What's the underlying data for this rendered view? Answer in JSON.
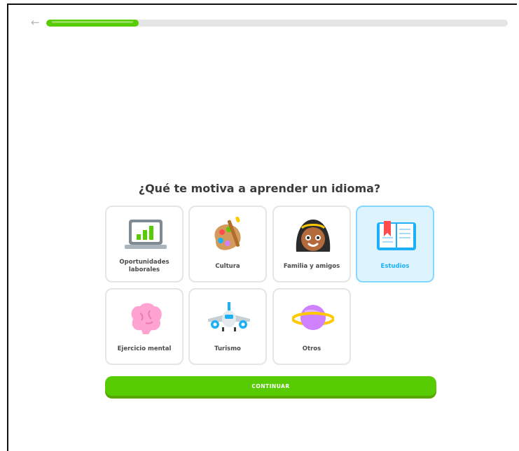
{
  "progress": {
    "fraction": 0.2
  },
  "question": "¿Qué te motiva a aprender un idioma?",
  "options": [
    {
      "label": "Oportunidades laborales",
      "icon": "laptop-chart-icon"
    },
    {
      "label": "Cultura",
      "icon": "palette-icon"
    },
    {
      "label": "Familia y amigos",
      "icon": "family-face-icon"
    },
    {
      "label": "Estudios",
      "icon": "book-icon",
      "selected": true
    },
    {
      "label": "Ejercicio mental",
      "icon": "brain-icon"
    },
    {
      "label": "Turismo",
      "icon": "airplane-icon"
    },
    {
      "label": "Otros",
      "icon": "planet-icon"
    }
  ],
  "continue_label": "CONTINUAR",
  "colors": {
    "accent": "#58cc02",
    "selected_bg": "#ddf4ff",
    "selected_text": "#1cb0f6"
  }
}
